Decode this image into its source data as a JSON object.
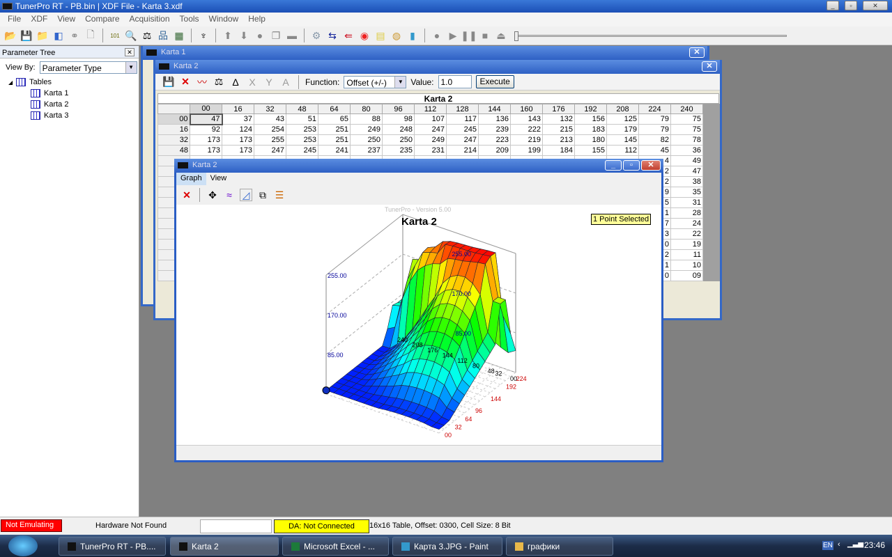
{
  "app": {
    "title": "TunerPro RT - PB.bin | XDF File - Karta 3.xdf"
  },
  "menu": [
    "File",
    "XDF",
    "View",
    "Compare",
    "Acquisition",
    "Tools",
    "Window",
    "Help"
  ],
  "param_tree": {
    "title": "Parameter Tree",
    "view_by_label": "View By:",
    "view_by_value": "Parameter Type",
    "root": "Tables",
    "items": [
      "Karta 1",
      "Karta 2",
      "Karta 3"
    ]
  },
  "karta1": {
    "title": "Karta 1"
  },
  "karta2": {
    "title": "Karta 2",
    "function_label": "Function:",
    "function_value": "Offset (+/-)",
    "value_label": "Value:",
    "value": "1.0",
    "execute": "Execute",
    "table_title": "Karta 2",
    "columns": [
      "00",
      "16",
      "32",
      "48",
      "64",
      "80",
      "96",
      "112",
      "128",
      "144",
      "160",
      "176",
      "192",
      "208",
      "224",
      "240"
    ],
    "rows": [
      {
        "label": "00",
        "values": [
          "47",
          "37",
          "43",
          "51",
          "65",
          "88",
          "98",
          "107",
          "117",
          "136",
          "143",
          "132",
          "156",
          "125",
          "79",
          "75"
        ]
      },
      {
        "label": "16",
        "values": [
          "92",
          "124",
          "254",
          "253",
          "251",
          "249",
          "248",
          "247",
          "245",
          "239",
          "222",
          "215",
          "183",
          "179",
          "79",
          "75"
        ]
      },
      {
        "label": "32",
        "values": [
          "173",
          "173",
          "255",
          "253",
          "251",
          "250",
          "250",
          "249",
          "247",
          "223",
          "219",
          "213",
          "180",
          "145",
          "82",
          "78"
        ]
      },
      {
        "label": "48",
        "values": [
          "173",
          "173",
          "247",
          "245",
          "241",
          "237",
          "235",
          "231",
          "214",
          "209",
          "199",
          "184",
          "155",
          "112",
          "45",
          "36"
        ]
      }
    ],
    "partial_col_224": [
      "4",
      "2",
      "2",
      "9",
      "5",
      "1",
      "7",
      "3",
      "0",
      "2",
      "1",
      "0"
    ],
    "partial_col_240": [
      "49",
      "47",
      "38",
      "35",
      "31",
      "28",
      "24",
      "22",
      "19",
      "11",
      "10",
      "09"
    ]
  },
  "graph": {
    "title": "Karta 2",
    "menu": [
      "Graph",
      "View"
    ],
    "watermark": "TunerPro - Version 5.00",
    "badge": "1 Point Selected",
    "chart_data": {
      "type": "surface3d",
      "title": "Karta 2",
      "z_ticks": [
        "85.00",
        "170.00",
        "255.00"
      ],
      "z_range": [
        0,
        255
      ],
      "x_ticks": [
        "240",
        "208",
        "176",
        "144",
        "112",
        "80",
        "48",
        "32",
        "00"
      ],
      "y_ticks": [
        "00",
        "32",
        "64",
        "96",
        "144",
        "192",
        "224"
      ],
      "colors": {
        "x_ticks": "#000000",
        "y_ticks": "#cc0000",
        "z_ticks": "#000099"
      }
    }
  },
  "status": {
    "emulation": "Not Emulating",
    "hardware": "Hardware Not Found",
    "da": "DA: Not Connected",
    "info": "16x16 Table, Offset: 0300,  Cell Size: 8 Bit"
  },
  "taskbar": {
    "items": [
      "TunerPro RT - PB....",
      "Karta 2",
      "Microsoft Excel - ...",
      "Карта 3.JPG - Paint",
      "графики"
    ],
    "lang": "EN",
    "time": "23:46"
  }
}
